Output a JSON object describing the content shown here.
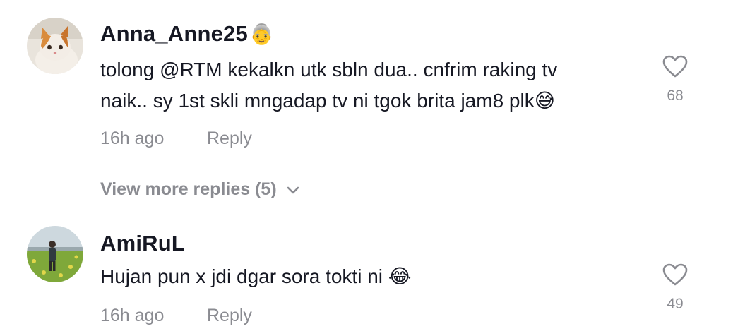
{
  "comments": [
    {
      "username": "Anna_Anne25",
      "username_emoji": "👵",
      "text_lines": [
        "tolong @RTM kekalkn utk sbln dua.. cnfrim raking tv",
        "naik.. sy 1st skli mngadap tv ni tgok brita jam8 plk😅"
      ],
      "time": "16h ago",
      "reply_label": "Reply",
      "likes": "68",
      "avatar_icon": "cat-avatar"
    },
    {
      "username": "AmiRuL",
      "text_lines": [
        "Hujan pun x jdi dgar sora tokti ni 😂"
      ],
      "time": "16h ago",
      "reply_label": "Reply",
      "likes": "49",
      "avatar_icon": "field-avatar"
    }
  ],
  "view_more": {
    "label": "View more replies (5)",
    "icon": "chevron-down-icon"
  },
  "colors": {
    "primary_text": "#161823",
    "secondary_text": "#8a8b91",
    "background": "#ffffff"
  }
}
